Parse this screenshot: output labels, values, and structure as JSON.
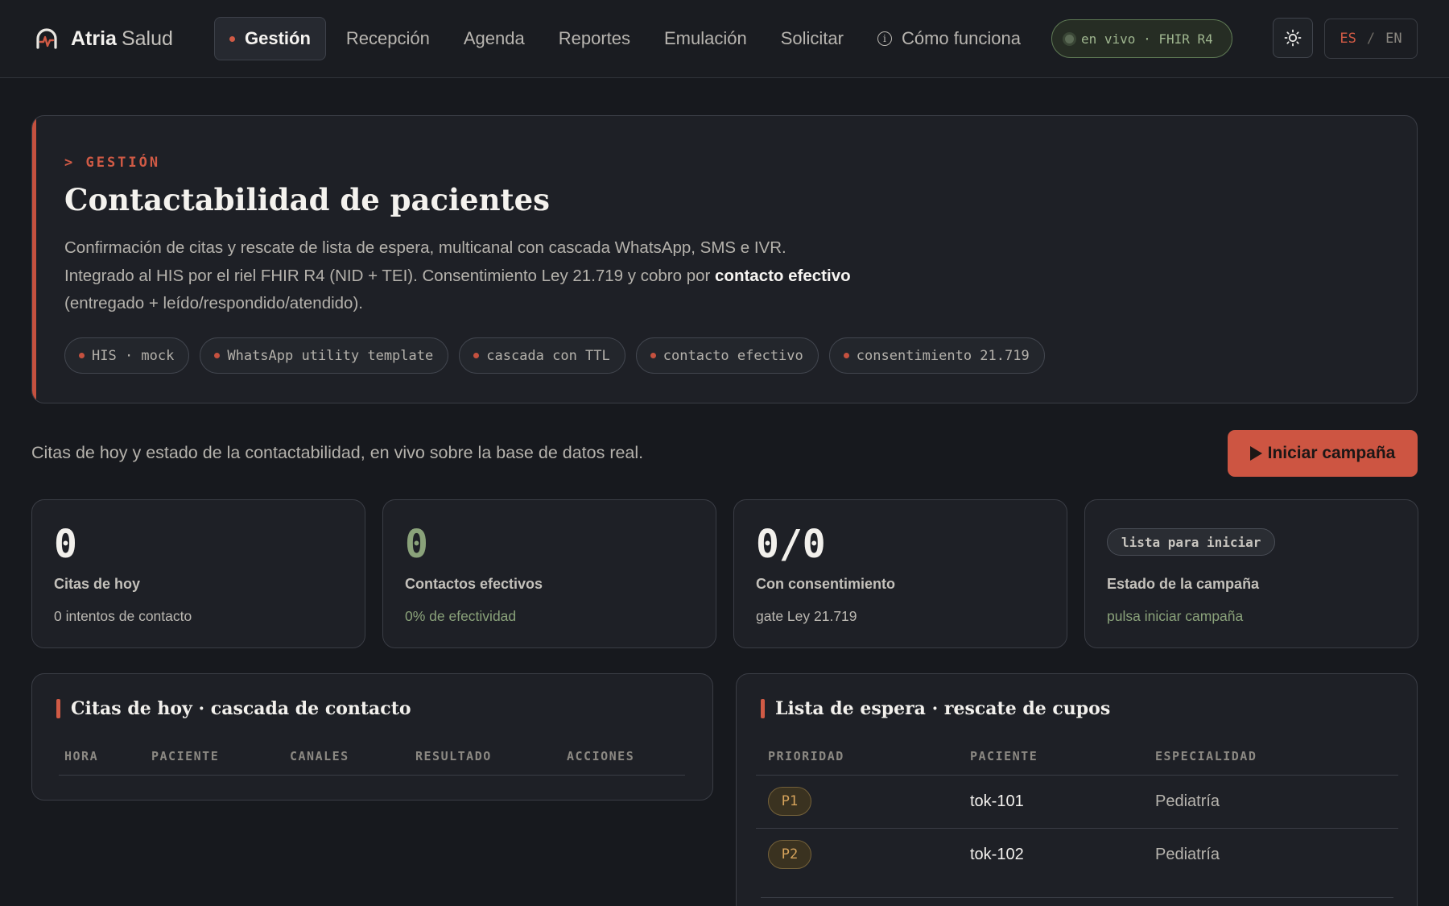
{
  "brand": {
    "name": "Atria",
    "sub": "Salud"
  },
  "nav": {
    "items": [
      "Gestión",
      "Recepción",
      "Agenda",
      "Reportes",
      "Emulación",
      "Solicitar"
    ],
    "help": "Cómo funciona",
    "live": "en vivo · FHIR R4",
    "lang": {
      "es": "ES",
      "sep": "/",
      "en": "EN"
    }
  },
  "hero": {
    "kicker": "> GESTIÓN",
    "title": "Contactabilidad de pacientes",
    "desc_1": "Confirmación de citas y rescate de lista de espera, multicanal con cascada WhatsApp, SMS e IVR. Integrado al HIS por el riel FHIR R4 (NID + TEI). Consentimiento Ley 21.719 y cobro por ",
    "desc_bold": "contacto efectivo",
    "desc_2": " (entregado + leído/respondido/atendido).",
    "tags": [
      "HIS · mock",
      "WhatsApp utility template",
      "cascada con TTL",
      "contacto efectivo",
      "consentimiento 21.719"
    ]
  },
  "summary": {
    "subtitle": "Citas de hoy y estado de la contactabilidad, en vivo sobre la base de datos real.",
    "start_button": "Iniciar campaña"
  },
  "stats": [
    {
      "value": "0",
      "label": "Citas de hoy",
      "sub": "0 intentos de contacto"
    },
    {
      "value": "0",
      "label": "Contactos efectivos",
      "sub": "0% de efectividad"
    },
    {
      "value": "0/0",
      "label": "Con consentimiento",
      "sub": "gate Ley 21.719"
    },
    {
      "badge": "lista para iniciar",
      "label": "Estado de la campaña",
      "sub": "pulsa iniciar campaña"
    }
  ],
  "appointments": {
    "title": "Citas de hoy · cascada de contacto",
    "columns": [
      "HORA",
      "PACIENTE",
      "CANALES",
      "RESULTADO",
      "ACCIONES"
    ],
    "rows": []
  },
  "waitlist": {
    "title": "Lista de espera · rescate de cupos",
    "columns": [
      "PRIORIDAD",
      "PACIENTE",
      "ESPECIALIDAD"
    ],
    "rows": [
      {
        "priority": "P1",
        "patient": "tok-101",
        "specialty": "Pediatría"
      },
      {
        "priority": "P2",
        "patient": "tok-102",
        "specialty": "Pediatría"
      }
    ]
  },
  "colors": {
    "accent": "#cd5542",
    "success": "#8aa27a",
    "warning": "#d6a35b",
    "background": "#17191e"
  },
  "icons": {
    "brand": "atria-logo-icon",
    "info": "info-icon",
    "theme": "sun-icon",
    "play": "play-icon"
  }
}
